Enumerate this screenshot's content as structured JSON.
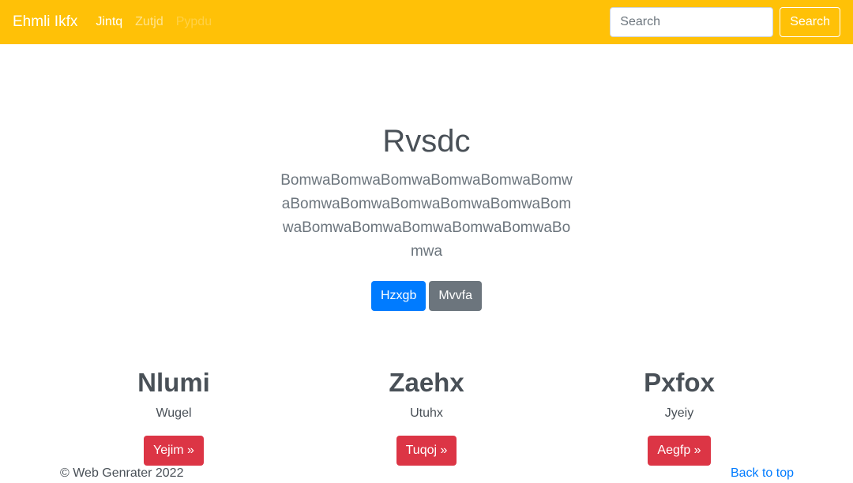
{
  "navbar": {
    "brand": "Ehmli Ikfx",
    "links": [
      {
        "label": "Jintq",
        "state": "active"
      },
      {
        "label": "Zutjd",
        "state": "muted"
      },
      {
        "label": "Pypdu",
        "state": "disabled"
      }
    ],
    "search_placeholder": "Search",
    "search_button": "Search",
    "color": "#ffc107"
  },
  "hero": {
    "title": "Rvsdc",
    "lead": "BomwaBomwaBomwaBomwaBomwaBomwaBomwaBomwaBomwaBomwaBomwaBomwaBomwaBomwaBomwaBomwaBomwaBomwa",
    "primary_button": "Hzxgb",
    "secondary_button": "Mvvfa"
  },
  "columns": [
    {
      "title": "Nlumi",
      "text": "Wugel",
      "button": "Yejim »"
    },
    {
      "title": "Zaehx",
      "text": "Utuhx",
      "button": "Tuqoj »"
    },
    {
      "title": "Pxfox",
      "text": "Jyeiy",
      "button": "Aegfp »"
    }
  ],
  "footer": {
    "copyright": "© Web Genrater 2022",
    "back_to_top": "Back to top"
  }
}
